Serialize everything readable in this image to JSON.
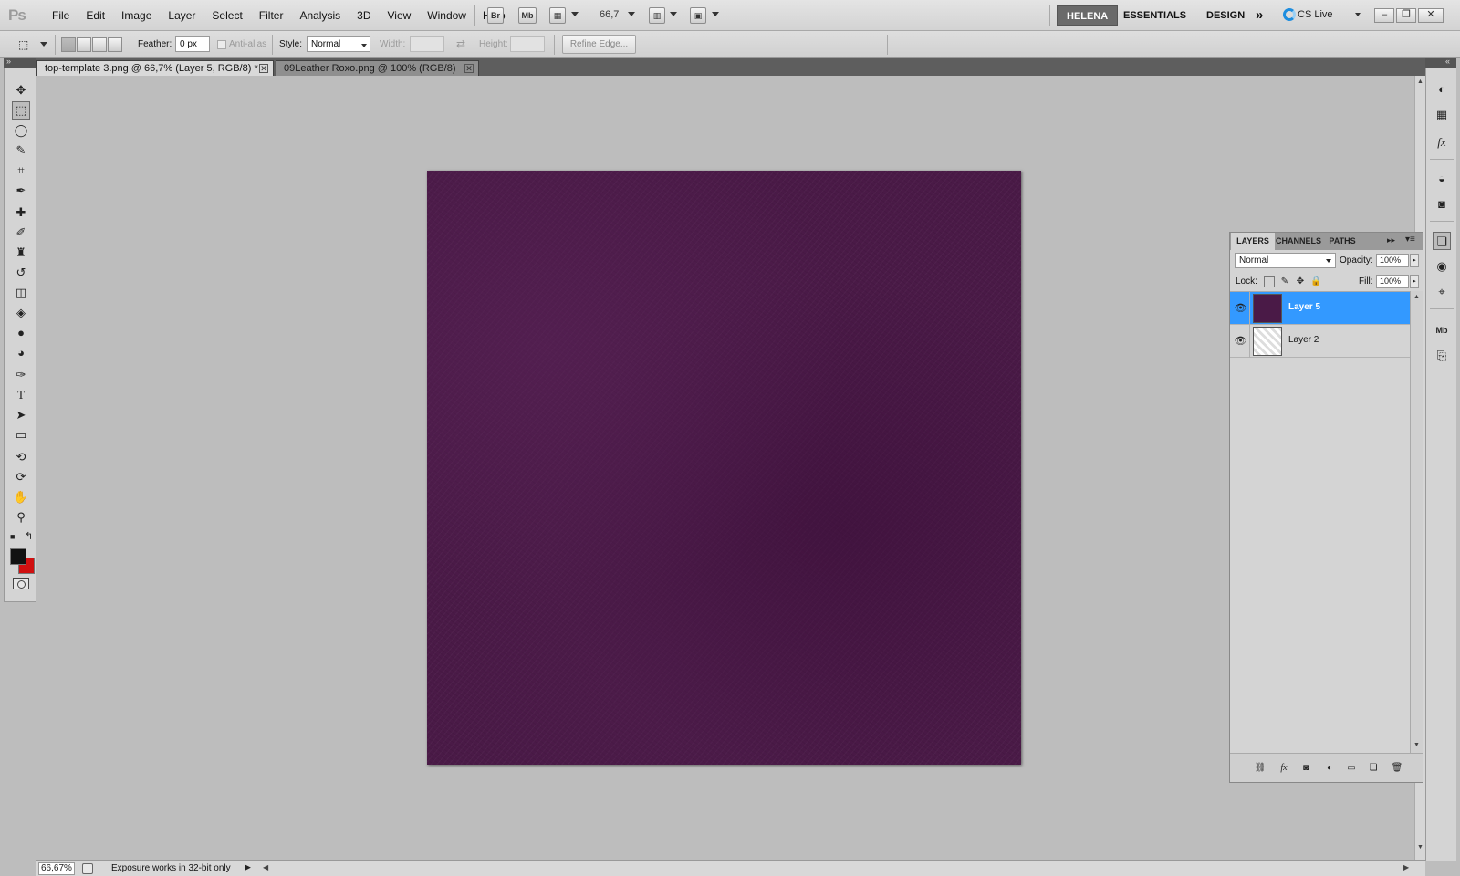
{
  "app": {
    "logo": "Ps",
    "menus": [
      "File",
      "Edit",
      "Image",
      "Layer",
      "Select",
      "Filter",
      "Analysis",
      "3D",
      "View",
      "Window",
      "Help"
    ],
    "bridge_label": "Br",
    "minibridge_label": "Mb",
    "zoom_level": "66,7",
    "workspaces": [
      "HELENA",
      "ESSENTIALS",
      "DESIGN"
    ],
    "more_workspaces": "»",
    "cs_live": "CS Live",
    "window_controls": {
      "minimize": "–",
      "restore": "❐",
      "close": "✕"
    }
  },
  "options": {
    "feather_label": "Feather:",
    "feather_value": "0 px",
    "antialias_label": "Anti-alias",
    "style_label": "Style:",
    "style_value": "Normal",
    "width_label": "Width:",
    "height_label": "Height:",
    "swap_icon": "⇄",
    "refine_edge": "Refine Edge..."
  },
  "tabs": [
    {
      "title": "top-template 3.png @ 66,7% (Layer 5, RGB/8) *",
      "active": true
    },
    {
      "title": "09Leather Roxo.png @ 100% (RGB/8)",
      "active": false
    }
  ],
  "tab_close": "✕",
  "document": {
    "fill_color": "#4a1a47"
  },
  "tools": [
    {
      "name": "move-tool-icon",
      "glyph": "✥"
    },
    {
      "name": "marquee-tool-icon",
      "glyph": "⬚",
      "active": true
    },
    {
      "name": "lasso-tool-icon",
      "glyph": "◯"
    },
    {
      "name": "quick-select-tool-icon",
      "glyph": "✎"
    },
    {
      "name": "crop-tool-icon",
      "glyph": "⌗"
    },
    {
      "name": "eyedropper-tool-icon",
      "glyph": "✒"
    },
    {
      "name": "healing-brush-tool-icon",
      "glyph": "✚"
    },
    {
      "name": "brush-tool-icon",
      "glyph": "✐"
    },
    {
      "name": "clone-stamp-tool-icon",
      "glyph": "♜"
    },
    {
      "name": "history-brush-tool-icon",
      "glyph": "↺"
    },
    {
      "name": "eraser-tool-icon",
      "glyph": "◫"
    },
    {
      "name": "paint-bucket-tool-icon",
      "glyph": "◈"
    },
    {
      "name": "blur-tool-icon",
      "glyph": "●"
    },
    {
      "name": "dodge-tool-icon",
      "glyph": "◕"
    },
    {
      "name": "pen-tool-icon",
      "glyph": "✑"
    },
    {
      "name": "type-tool-icon",
      "glyph": "T"
    },
    {
      "name": "path-select-tool-icon",
      "glyph": "➤"
    },
    {
      "name": "shape-tool-icon",
      "glyph": "▭"
    },
    {
      "name": "3d-rotate-tool-icon",
      "glyph": "⟲"
    },
    {
      "name": "3d-orbit-tool-icon",
      "glyph": "⟳"
    },
    {
      "name": "hand-tool-icon",
      "glyph": "✋"
    },
    {
      "name": "zoom-tool-icon",
      "glyph": "⚲"
    }
  ],
  "colors": {
    "foreground": "#111111",
    "background": "#d01010",
    "selection": "#3399ff"
  },
  "status": {
    "zoom": "66,67%",
    "text": "Exposure works in 32-bit only",
    "menu_arrow": "▶"
  },
  "layers_panel": {
    "tabs": [
      "LAYERS",
      "CHANNELS",
      "PATHS"
    ],
    "blend_mode": "Normal",
    "opacity_label": "Opacity:",
    "opacity_value": "100%",
    "lock_label": "Lock:",
    "fill_label": "Fill:",
    "fill_value": "100%",
    "layers": [
      {
        "name": "Layer 5",
        "visible": true,
        "selected": true
      },
      {
        "name": "Layer 2",
        "visible": true,
        "selected": false
      }
    ],
    "footer_icons": [
      "link-layers-icon",
      "fx-icon",
      "add-mask-icon",
      "adjustment-layer-icon",
      "new-group-icon",
      "new-layer-icon",
      "delete-layer-icon"
    ]
  },
  "dock_icons": [
    "color-panel-icon",
    "swatches-panel-icon",
    "styles-panel-icon",
    "adjustments-panel-icon",
    "masks-panel-icon",
    "layers-panel-icon",
    "channels-panel-icon",
    "paths-panel-icon",
    "minibridge-panel-icon",
    "history-panel-icon"
  ]
}
